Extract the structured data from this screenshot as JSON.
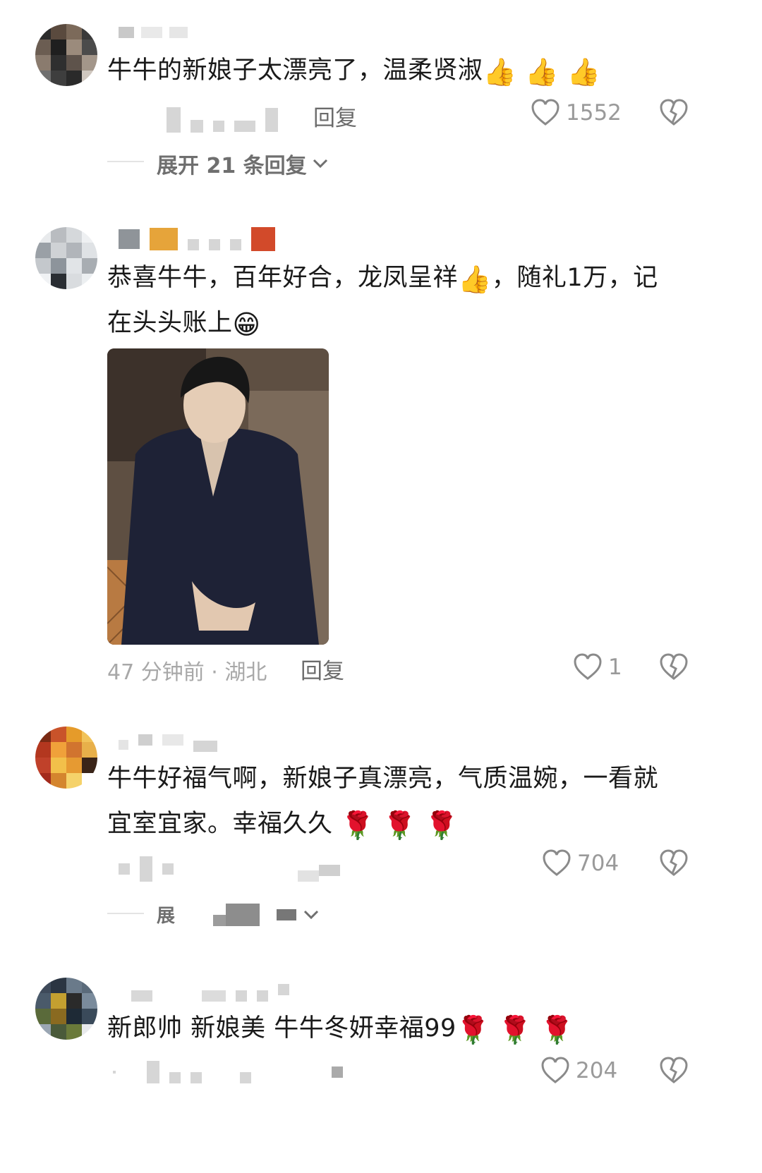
{
  "comments": [
    {
      "text": "牛牛的新娘子太漂亮了，温柔贤淑",
      "emojis": [
        "👍",
        "👍",
        "👍"
      ],
      "reply_label": "回复",
      "likes": "1552",
      "expand_label": "展开 21 条回复"
    },
    {
      "text_line1": "恭喜牛牛，百年好合，龙凤呈祥",
      "emoji_inline": "👍",
      "text_line1b": "，随礼1万，记",
      "text_line2": "在头头账上",
      "emoji_end": "😁",
      "meta": "47 分钟前 · 湖北",
      "reply_label": "回复",
      "likes": "1"
    },
    {
      "text_line1": "牛牛好福气啊，新娘子真漂亮，气质温婉，一看就",
      "text_line2": "宜室宜家。幸福久久",
      "emojis": [
        "🌹",
        "🌹",
        "🌹"
      ],
      "likes": "704",
      "expand_label": "展"
    },
    {
      "text": "新郎帅 新娘美 牛牛冬妍幸福99",
      "emojis": [
        "🌹",
        "🌹",
        "🌹"
      ],
      "likes": "204"
    }
  ],
  "colors": {
    "text": "#1a1a1a",
    "meta": "#a8a8a8",
    "icon": "#8a8a8a"
  }
}
